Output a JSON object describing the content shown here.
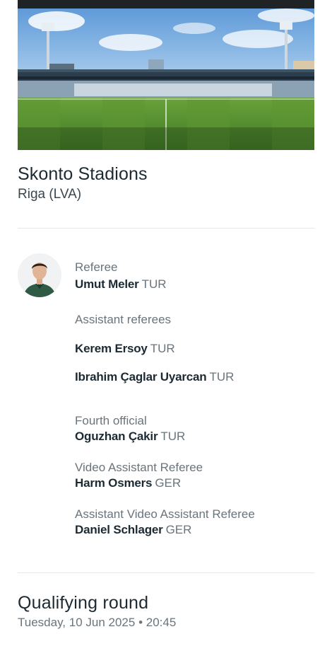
{
  "venue": {
    "name": "Skonto Stadions",
    "city": "Riga (LVA)"
  },
  "officials": {
    "referee": {
      "label": "Referee",
      "name": "Umut Meler",
      "country": "TUR"
    },
    "assistants": {
      "label": "Assistant referees",
      "people": [
        {
          "name": "Kerem Ersoy",
          "country": "TUR"
        },
        {
          "name": "Ibrahim Çaglar Uyarcan",
          "country": "TUR"
        }
      ]
    },
    "fourth": {
      "label": "Fourth official",
      "name": "Oguzhan Çakir",
      "country": "TUR"
    },
    "var": {
      "label": "Video Assistant Referee",
      "name": "Harm Osmers",
      "country": "GER"
    },
    "avar": {
      "label": "Assistant Video Assistant Referee",
      "name": "Daniel Schlager",
      "country": "GER"
    }
  },
  "match": {
    "round": "Qualifying round",
    "date": "Tuesday, 10 Jun 2025",
    "separator": "•",
    "time": "20:45"
  },
  "colors": {
    "text_primary": "#1c2a33",
    "text_secondary": "#6a747b",
    "divider": "#e3e7ea",
    "pitch": "#4f8a2e",
    "sky": "#7fb3e6"
  }
}
